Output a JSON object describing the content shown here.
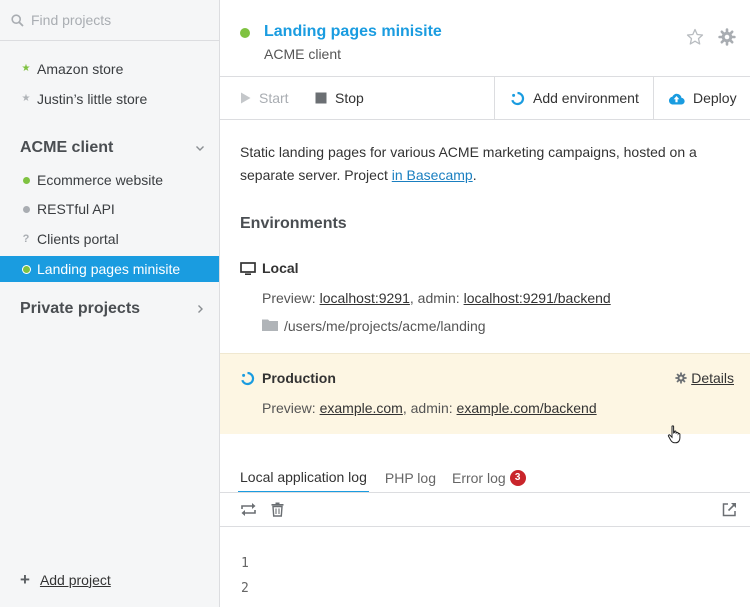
{
  "search": {
    "placeholder": "Find projects"
  },
  "sidebar": {
    "favorites": [
      {
        "label": "Amazon store",
        "icon": "star-icon",
        "color": "#7fc241"
      },
      {
        "label": "Justin’s little store",
        "icon": "star-icon",
        "color": "#b0b4b8"
      }
    ],
    "group_acme": {
      "label": "ACME client",
      "items": [
        {
          "label": "Ecommerce website",
          "status_color": "#7fc241"
        },
        {
          "label": "RESTful API",
          "status_color": "#a9adb2"
        },
        {
          "label": "Clients portal",
          "status": "?"
        },
        {
          "label": "Landing pages minisite",
          "status_color": "#7fc241"
        }
      ]
    },
    "group_private": {
      "label": "Private projects"
    },
    "add_project": "Add project"
  },
  "header": {
    "title": "Landing pages minisite",
    "subtitle": "ACME client",
    "status_color": "#7fc241"
  },
  "toolbar": {
    "start": "Start",
    "stop": "Stop",
    "add_environment": "Add environment",
    "deploy": "Deploy"
  },
  "description": {
    "text": "Static landing pages for various ACME marketing campaigns, hosted on a separate server. Project ",
    "link": "in Basecamp",
    "suffix": "."
  },
  "environments": {
    "heading": "Environments",
    "local": {
      "name": "Local",
      "preview_label": "Preview: ",
      "preview_link": "localhost:9291",
      "admin_label": ", admin: ",
      "admin_link": "localhost:9291/backend",
      "path": "/users/me/projects/acme/landing"
    },
    "production": {
      "name": "Production",
      "details": "Details",
      "preview_label": "Preview: ",
      "preview_link": "example.com",
      "admin_label": ", admin: ",
      "admin_link": "example.com/backend"
    }
  },
  "log": {
    "tabs": [
      {
        "label": "Local application log",
        "active": true
      },
      {
        "label": "PHP log"
      },
      {
        "label": "Error log",
        "badge": "3"
      }
    ],
    "lines": [
      "1",
      "2"
    ]
  },
  "colors": {
    "accent": "#1a9ce0",
    "highlight_bg": "#fdf6e3",
    "error": "#c9252b"
  }
}
